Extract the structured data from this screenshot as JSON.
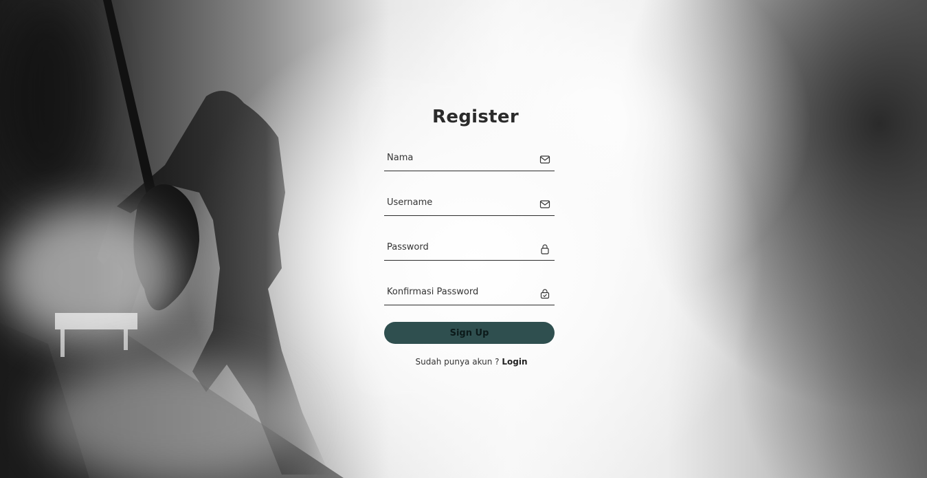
{
  "form": {
    "title": "Register",
    "fields": [
      {
        "placeholder": "Nama",
        "icon": "envelope-icon"
      },
      {
        "placeholder": "Username",
        "icon": "envelope-icon"
      },
      {
        "placeholder": "Password",
        "icon": "lock-icon"
      },
      {
        "placeholder": "Konfirmasi Password",
        "icon": "lock-check-icon"
      }
    ],
    "submit_label": "Sign Up",
    "footer_text": "Sudah punya akun ? ",
    "footer_link": "Login"
  },
  "colors": {
    "button": "#2f4f4f",
    "title": "#2b2b2b"
  }
}
